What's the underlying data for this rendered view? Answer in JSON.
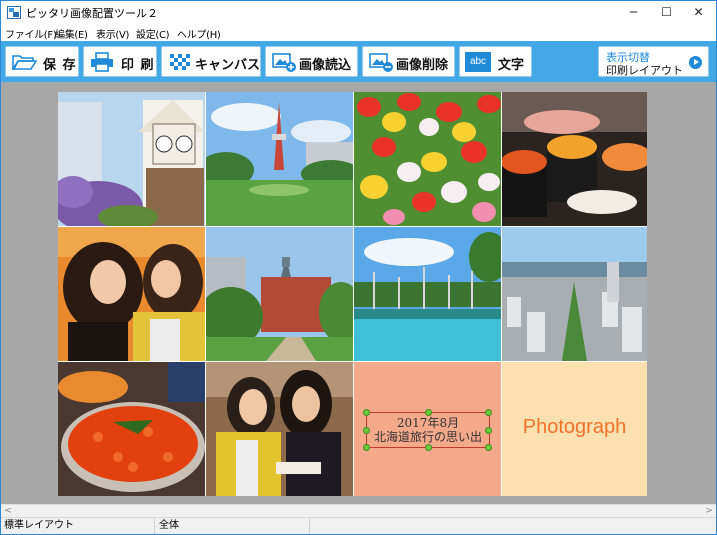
{
  "window": {
    "title": "ピッタリ画像配置ツール２",
    "min_glyph": "─",
    "max_glyph": "☐",
    "close_glyph": "✕"
  },
  "menu": [
    {
      "label": "ファイル(F)"
    },
    {
      "label": "編集(E)"
    },
    {
      "label": "表示(V)"
    },
    {
      "label": "設定(C)"
    },
    {
      "label": "ヘルプ(H)"
    }
  ],
  "toolbar": {
    "save_label": "保 存",
    "print_label": "印 刷",
    "canvas_label": "キャンバス",
    "image_load_label": "画像読込",
    "image_delete_label": "画像削除",
    "text_label": "文字",
    "text_icon_text": "abc",
    "switch_line1": "表示切替",
    "switch_line2": "印刷レイアウト"
  },
  "canvas": {
    "cells": [
      {
        "name": "clock-tower-photo"
      },
      {
        "name": "tv-tower-park-photo"
      },
      {
        "name": "tulip-field-photo"
      },
      {
        "name": "sushi-photo"
      },
      {
        "name": "two-women-laughing-photo"
      },
      {
        "name": "red-brick-building-photo"
      },
      {
        "name": "blue-pond-photo"
      },
      {
        "name": "city-aerial-photo"
      },
      {
        "name": "salmon-roe-bowl-photo"
      },
      {
        "name": "two-women-smiling-photo"
      }
    ],
    "caption_line1": "2017年8月",
    "caption_line2": "北海道旅行の思い出",
    "photograph_text": "Photograph",
    "colors": {
      "caption_tile": "#f3a98a",
      "photograph_tile": "#fde0b0",
      "photograph_text": "#f0732c",
      "selection_border": "#c0392b",
      "handle": "#6ccd3c"
    }
  },
  "scrollbar": {
    "left_arrow": "<",
    "right_arrow": ">"
  },
  "status": {
    "layout": "標準レイアウト",
    "scope": "全体"
  },
  "colors": {
    "toolbar_bg": "#42a8e6",
    "workspace_bg": "#a7a7a7",
    "accent": "#1e8ad8"
  }
}
